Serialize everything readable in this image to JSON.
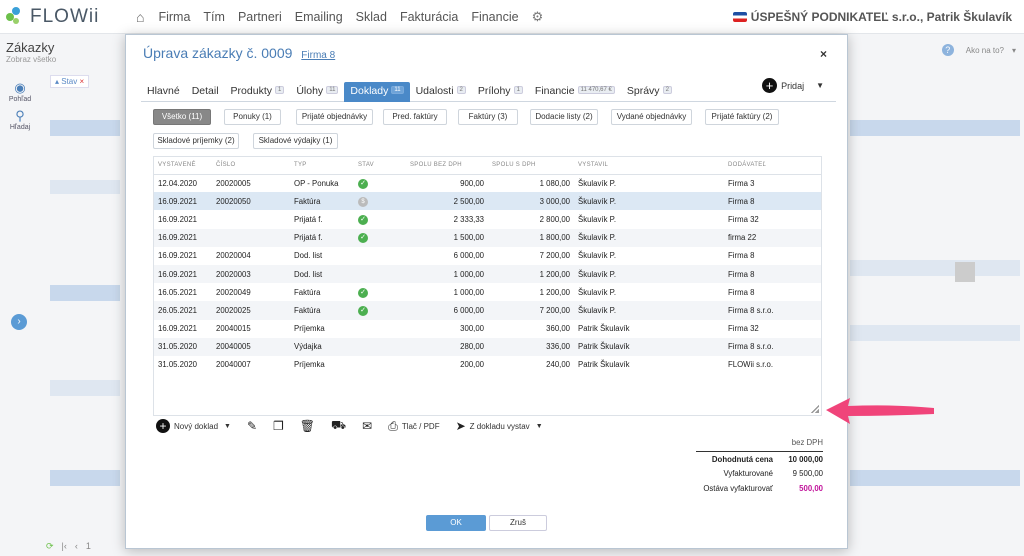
{
  "app": {
    "logo_text": "FLOWii",
    "nav": [
      "Firma",
      "Tím",
      "Partneri",
      "Emailing",
      "Sklad",
      "Fakturácia",
      "Financie"
    ],
    "company": "ÚSPEŠNÝ PODNIKATEĽ s.r.o., Patrik Škulavík"
  },
  "background": {
    "title": "Zákazky",
    "subtitle": "Zobraz všetko",
    "side_view": "Pohľad",
    "side_search": "Hľadaj",
    "filter_chip": "Stav",
    "help": "Ako na to?",
    "page_number": "1"
  },
  "modal": {
    "title": "Úprava zákazky č. 0009",
    "firm_link": "Firma 8",
    "close": "×",
    "tabs": [
      {
        "label": "Hlavné",
        "count": ""
      },
      {
        "label": "Detail",
        "count": ""
      },
      {
        "label": "Produkty",
        "count": "1"
      },
      {
        "label": "Úlohy",
        "count": "11"
      },
      {
        "label": "Doklady",
        "count": "11"
      },
      {
        "label": "Udalosti",
        "count": "2"
      },
      {
        "label": "Prílohy",
        "count": "1"
      },
      {
        "label": "Financie",
        "count": "11 470,67 €"
      },
      {
        "label": "Správy",
        "count": "2"
      }
    ],
    "add_label": "Pridaj",
    "filters": [
      "Všetko (11)",
      "Ponuky (1)",
      "Prijaté objednávky",
      "Pred. faktúry",
      "Faktúry (3)",
      "Dodacie listy (2)",
      "Vydané objednávky",
      "Prijaté faktúry (2)",
      "Skladové príjemky (2)",
      "Skladové výdajky (1)"
    ],
    "columns": [
      "VYSTAVENÉ",
      "ČÍSLO",
      "TYP",
      "STAV",
      "SPOLU BEZ DPH",
      "SPOLU S DPH",
      "VYSTAVIL",
      "DODÁVATEĽ"
    ],
    "rows": [
      {
        "date": "12.04.2020",
        "number": "20020005",
        "type": "OP - Ponuka",
        "status": "ok",
        "net": "900,00",
        "gross": "1 080,00",
        "issuer": "Škulavík P.",
        "supplier": "Firma 3"
      },
      {
        "date": "16.09.2021",
        "number": "20020050",
        "type": "Faktúra",
        "status": "partial",
        "net": "2 500,00",
        "gross": "3 000,00",
        "issuer": "Škulavík P.",
        "supplier": "Firma 8"
      },
      {
        "date": "16.09.2021",
        "number": "",
        "type": "Prijatá f.",
        "status": "ok",
        "net": "2 333,33",
        "gross": "2 800,00",
        "issuer": "Škulavík P.",
        "supplier": "Firma 32"
      },
      {
        "date": "16.09.2021",
        "number": "",
        "type": "Prijatá f.",
        "status": "ok",
        "net": "1 500,00",
        "gross": "1 800,00",
        "issuer": "Škulavík P.",
        "supplier": "firma 22"
      },
      {
        "date": "16.09.2021",
        "number": "20020004",
        "type": "Dod. list",
        "status": "",
        "net": "6 000,00",
        "gross": "7 200,00",
        "issuer": "Škulavík P.",
        "supplier": "Firma 8"
      },
      {
        "date": "16.09.2021",
        "number": "20020003",
        "type": "Dod. list",
        "status": "",
        "net": "1 000,00",
        "gross": "1 200,00",
        "issuer": "Škulavík P.",
        "supplier": "Firma 8"
      },
      {
        "date": "16.05.2021",
        "number": "20020049",
        "type": "Faktúra",
        "status": "ok",
        "net": "1 000,00",
        "gross": "1 200,00",
        "issuer": "Škulavík P.",
        "supplier": "Firma 8"
      },
      {
        "date": "26.05.2021",
        "number": "20020025",
        "type": "Faktúra",
        "status": "ok",
        "net": "6 000,00",
        "gross": "7 200,00",
        "issuer": "Škulavík P.",
        "supplier": "Firma 8 s.r.o."
      },
      {
        "date": "16.09.2021",
        "number": "20040015",
        "type": "Príjemka",
        "status": "",
        "net": "300,00",
        "gross": "360,00",
        "issuer": "Patrik Škulavík",
        "supplier": "Firma 32"
      },
      {
        "date": "31.05.2020",
        "number": "20040005",
        "type": "Výdajka",
        "status": "",
        "net": "280,00",
        "gross": "336,00",
        "issuer": "Patrik Škulavík",
        "supplier": "Firma 8 s.r.o."
      },
      {
        "date": "31.05.2020",
        "number": "20040007",
        "type": "Príjemka",
        "status": "",
        "net": "200,00",
        "gross": "240,00",
        "issuer": "Patrik Škulavík",
        "supplier": "FLOWii s.r.o."
      }
    ],
    "toolbar": {
      "new_doc": "Nový doklad",
      "print": "Tlač / PDF",
      "from_doc": "Z dokladu vystav"
    },
    "summary": {
      "header": "bez DPH",
      "agreed_label": "Dohodnutá cena",
      "agreed_value": "10 000,00",
      "invoiced_label": "Vyfakturované",
      "invoiced_value": "9 500,00",
      "remaining_label": "Ostáva vyfakturovať",
      "remaining_value": "500,00"
    },
    "ok_label": "OK",
    "cancel_label": "Zruš"
  },
  "colors": {
    "accent": "#4a89c8",
    "status_ok": "#4caf50",
    "remaining": "#c2149b",
    "arrow": "#f0447a"
  }
}
